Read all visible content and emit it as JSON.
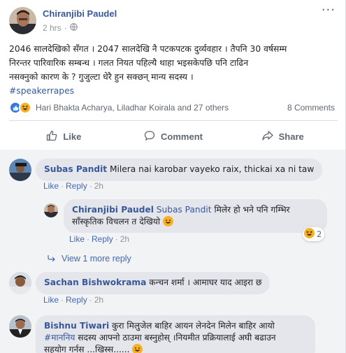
{
  "post": {
    "author": "Chiranjibi Paudel",
    "time": "2 hrs",
    "privacy_icon": "globe-icon",
    "more_label": "···",
    "line1": "2046 सालदेखिको सँगत । 2047 सालदेखि नै पटकपटक दुर्व्यवहार । तैपनि 30 वर्षसम्म",
    "line2": "निरन्तर पारिवारिक सम्बन्ध । गलत नियत पहिल्यै थाहा भइसकेपछि पनि टाढिन",
    "line3": "नसक्नुको कारण के ? गुजुल्टा धेरै हुन सक्छन् मान्य सदस्य ।",
    "hashtag": "#speakerrapes"
  },
  "reactions": {
    "names": "Hari Bhakta Acharya, Liladhar Koirala and 27 others",
    "comments_count": "8 Comments",
    "colors": {
      "like": "#3578e5",
      "haha": "#f7b125"
    }
  },
  "actions": {
    "like": "Like",
    "comment": "Comment",
    "share": "Share"
  },
  "comments": [
    {
      "author": "Subas Pandit",
      "text": "Milera nai karobar vayeko raix, thickai xa ni taw",
      "like": "Like",
      "reply": "Reply",
      "time": "2h"
    },
    {
      "author": "Chiranjibi Paudel",
      "mention": "Subas Pandit",
      "text1": "मिलेर हो भने पनि गम्भिर",
      "text2": "साँस्कृतिक विचलन त देखियो",
      "like": "Like",
      "reply": "Reply",
      "time": "2h",
      "reaction_count": "2"
    },
    {
      "author": "Sachan Bishwokrama",
      "text": "कन्चन शर्मा । आमाघर याद आइरा छ",
      "like": "Like",
      "reply": "Reply",
      "time": "2h"
    },
    {
      "author": "Bishnu Tiwari",
      "text1": "कुरा मिलुजेल बाहिर आयन लेनदेन मिलेन बाहिर आयो",
      "text2a": "#माननिय",
      "text2b": " सदस्य आफ्नो ठाउमा बस्नुहोस् ।नियमीत प्रक्रियालाई अघी बढाउन",
      "text3": "सहयोग गर्नस ...खिस्स......"
    }
  ],
  "view_more": "View 1 more reply"
}
